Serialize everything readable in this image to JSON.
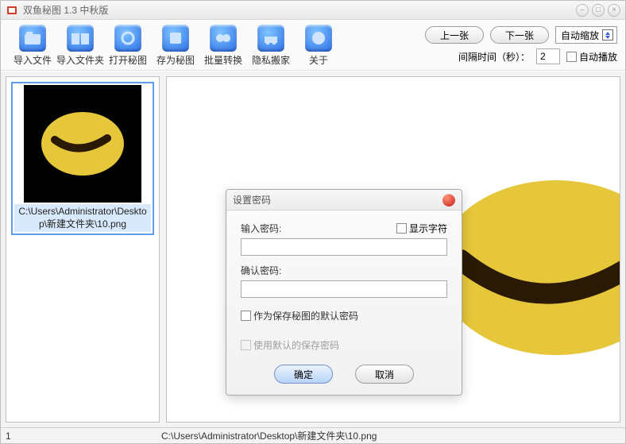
{
  "window": {
    "title": "双鱼秘图 1.3 中秋版"
  },
  "toolbar": {
    "items": [
      {
        "label": "导入文件"
      },
      {
        "label": "导入文件夹"
      },
      {
        "label": "打开秘图"
      },
      {
        "label": "存为秘图"
      },
      {
        "label": "批量转换"
      },
      {
        "label": "隐私搬家"
      },
      {
        "label": "关于"
      }
    ],
    "prev": "上一张",
    "next": "下一张",
    "zoom_mode": "自动缩放",
    "interval_label": "间隔时间（秒）：",
    "interval_value": "2",
    "autoplay_label": "自动播放"
  },
  "thumbs": {
    "items": [
      {
        "caption": "C:\\Users\\Administrator\\Desktop\\新建文件夹\\10.png"
      }
    ]
  },
  "dialog": {
    "title": "设置密码",
    "input_label": "输入密码:",
    "confirm_label": "确认密码:",
    "show_chars": "显示字符",
    "opt_default_save": "作为保存秘图的默认密码",
    "opt_use_default": "使用默认的保存密码",
    "ok": "确定",
    "cancel": "取消",
    "input_value": "",
    "confirm_value": ""
  },
  "status": {
    "left": "1",
    "right": "C:\\Users\\Administrator\\Desktop\\新建文件夹\\10.png"
  }
}
